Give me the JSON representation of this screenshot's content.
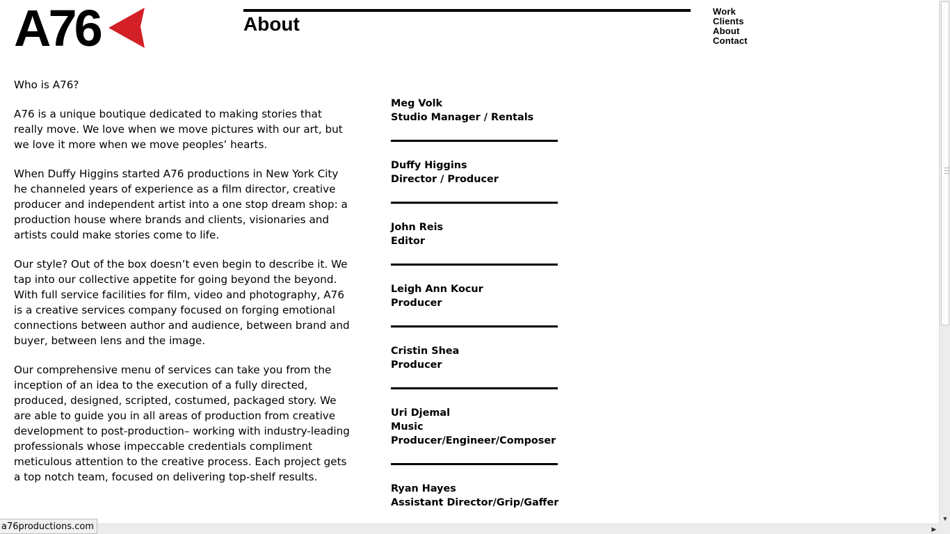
{
  "logo": {
    "text": "A76",
    "mark_color": "#d42027"
  },
  "header": {
    "title": "About"
  },
  "nav": {
    "items": [
      "Work",
      "Clients",
      "About",
      "Contact"
    ]
  },
  "intro": {
    "question": "Who is A76?",
    "paragraphs": [
      "A76 is a unique boutique dedicated to making stories that really move. We love when we move pictures with our art, but we love it more when we move peoples’ hearts.",
      "When Duffy Higgins started A76 productions in New York City he channeled years of experience as a film director, creative producer and independent artist into a one stop dream shop: a production house where brands and clients, visionaries and artists could make stories come to life.",
      "Our style? Out of the box doesn’t even begin to describe it. We tap into our collective appetite for going beyond the beyond. With full service facilities for film, video and photography, A76 is a creative services company focused on forging emotional connections between author and audience, between brand and buyer, between lens and the image.",
      "Our comprehensive menu of services can take you from the inception of an idea to the execution of a fully directed, produced, designed, scripted, costumed, packaged story. We are able to guide you in all areas of production from creative development to post-production– working with industry-leading professionals whose impeccable credentials compliment meticulous attention to the creative process. Each project gets a top notch team, focused on delivering top-shelf results."
    ]
  },
  "team": [
    {
      "name": "Meg Volk",
      "roles": [
        "Studio Manager / Rentals"
      ]
    },
    {
      "name": "Duffy Higgins",
      "roles": [
        "Director / Producer"
      ]
    },
    {
      "name": "John Reis",
      "roles": [
        "Editor"
      ]
    },
    {
      "name": "Leigh Ann Kocur",
      "roles": [
        "Producer"
      ]
    },
    {
      "name": "Cristin Shea",
      "roles": [
        "Producer"
      ]
    },
    {
      "name": "Uri Djemal",
      "roles": [
        "Music",
        "Producer/Engineer/Composer"
      ]
    },
    {
      "name": "Ryan Hayes",
      "roles": [
        "Assistant Director/Grip/Gaffer"
      ]
    }
  ],
  "status_bar": {
    "url": "a76productions.com"
  },
  "icons": {
    "scroll_down": "arrow-down-icon",
    "scroll_right": "arrow-right-icon"
  }
}
